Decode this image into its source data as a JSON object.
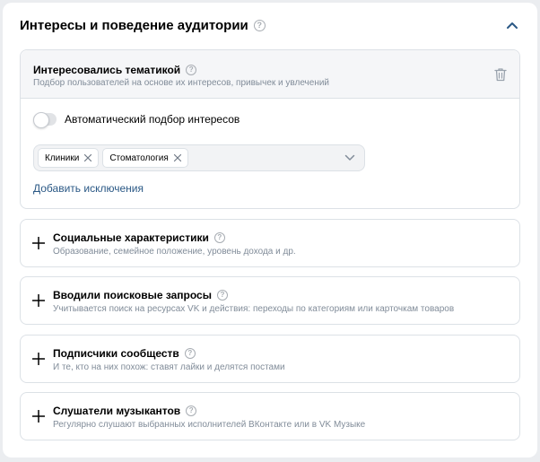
{
  "section": {
    "title": "Интересы и поведение аудитории",
    "help_icon": "?",
    "collapse_icon": "chevron-up-icon"
  },
  "expanded_card": {
    "title": "Интересовались тематикой",
    "subtitle": "Подбор пользователей на основе их интересов, привычек и увлечений",
    "toggle_label": "Автоматический подбор интересов",
    "toggle_on": false,
    "tags": [
      "Клиники",
      "Стоматология"
    ],
    "exclusions_link": "Добавить исключения"
  },
  "collapsed_cards": [
    {
      "title": "Социальные характеристики",
      "subtitle": "Образование, семейное положение, уровень дохода и др."
    },
    {
      "title": "Вводили поисковые запросы",
      "subtitle": "Учитывается поиск на ресурсах VK и действия: переходы по категориям или карточкам товаров"
    },
    {
      "title": "Подписчики сообществ",
      "subtitle": "И те, кто на них похож: ставят лайки и делятся постами"
    },
    {
      "title": "Слушатели музыкантов",
      "subtitle": "Регулярно слушают выбранных исполнителей ВКонтакте или в VK Музыке"
    }
  ],
  "colors": {
    "accent": "#2a5885",
    "muted": "#818c99",
    "border": "#dce1e6"
  }
}
